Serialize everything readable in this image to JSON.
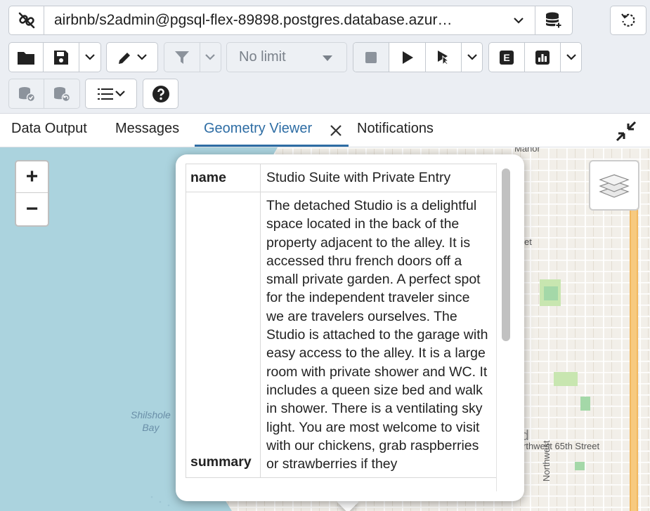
{
  "toolbar": {
    "connection": "airbnb/s2admin@pgsql-flex-89898.postgres.database.azur…",
    "limit": "No limit",
    "explain_icon_letter": "E"
  },
  "tabs": {
    "data_output": "Data Output",
    "messages": "Messages",
    "geometry_viewer": "Geometry Viewer",
    "notifications": "Notifications"
  },
  "map": {
    "zoom_in": "+",
    "zoom_out": "−",
    "label_bay": "Shilshole\nBay",
    "label_street": "rthwest 65th Street",
    "label_manor": "Manor",
    "label_et": "et",
    "label_northwest": "Northwest",
    "label_rd": "rd"
  },
  "popup": {
    "rows": [
      {
        "key": "name",
        "value": "Studio Suite with Private Entry"
      },
      {
        "key": "summary",
        "value": "The detached Studio is a delightful space located in the back of the property adjacent to the alley. It is accessed thru french doors off a small private garden. A perfect spot for the independent traveler since we are travelers ourselves. The Studio is attached to the garage with easy access to the alley. It is a large room with private shower and WC. It includes a queen size bed and walk in shower. There is a ventilating sky light. You are most welcome to visit with our chickens, grab raspberries or strawberries if they"
      }
    ]
  },
  "colors": {
    "accent": "#2e6da4",
    "water": "#abd3de",
    "land": "#f2efe9",
    "road": "#f2b860"
  }
}
